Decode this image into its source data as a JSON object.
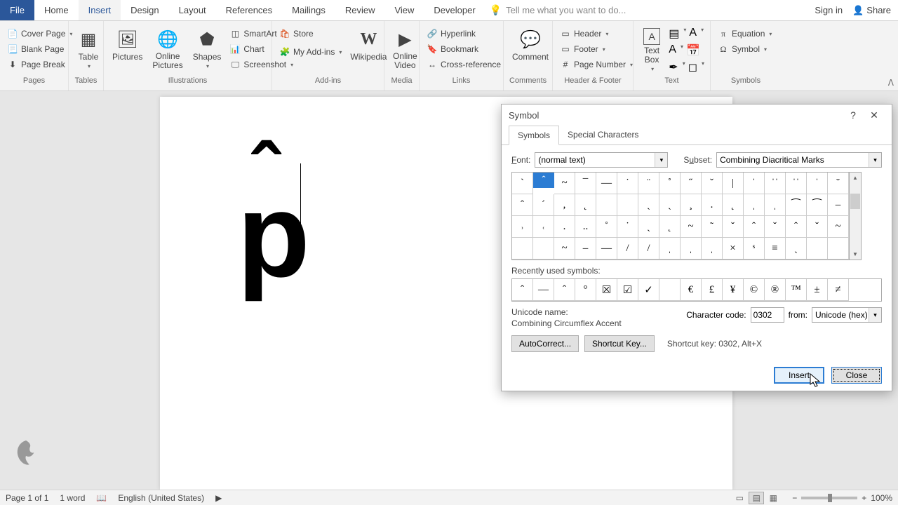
{
  "menubar": {
    "tabs": [
      "File",
      "Home",
      "Insert",
      "Design",
      "Layout",
      "References",
      "Mailings",
      "Review",
      "View",
      "Developer"
    ],
    "active": "Insert",
    "tellme": "Tell me what you want to do...",
    "signin": "Sign in",
    "share": "Share"
  },
  "ribbon": {
    "pages": {
      "label": "Pages",
      "cover": "Cover Page",
      "blank": "Blank Page",
      "break": "Page Break"
    },
    "tables": {
      "label": "Tables",
      "table": "Table"
    },
    "illus": {
      "label": "Illustrations",
      "pictures": "Pictures",
      "online": "Online Pictures",
      "shapes": "Shapes",
      "smartart": "SmartArt",
      "chart": "Chart",
      "screenshot": "Screenshot"
    },
    "addins": {
      "label": "Add-ins",
      "store": "Store",
      "myaddins": "My Add-ins",
      "wikipedia": "Wikipedia"
    },
    "media": {
      "label": "Media",
      "video": "Online Video"
    },
    "links": {
      "label": "Links",
      "hyperlink": "Hyperlink",
      "bookmark": "Bookmark",
      "crossref": "Cross-reference"
    },
    "comments": {
      "label": "Comments",
      "comment": "Comment"
    },
    "headerfooter": {
      "label": "Header & Footer",
      "header": "Header",
      "footer": "Footer",
      "pagenum": "Page Number"
    },
    "text": {
      "label": "Text",
      "textbox": "Text Box"
    },
    "symbols": {
      "label": "Symbols",
      "equation": "Equation",
      "symbol": "Symbol"
    }
  },
  "document": {
    "char": "p",
    "accent": "ˆ"
  },
  "dialog": {
    "title": "Symbol",
    "tabs": [
      "Symbols",
      "Special Characters"
    ],
    "font_label": "Font:",
    "font_value": "(normal text)",
    "subset_label": "Subset:",
    "subset_value": "Combining Diacritical Marks",
    "grid": [
      [
        "`",
        "ˆ",
        "~",
        "¯",
        "—",
        "˙",
        "¨",
        "˚",
        "˝",
        "ˇ",
        "|",
        "ˈ",
        "ˈˈ",
        "ˈˈ",
        "ˈ",
        "˘"
      ],
      [
        "ˆ",
        "´",
        ",",
        "˛",
        "",
        "",
        "ˏ",
        "ˏ",
        "¸",
        ".",
        "˛",
        "ˌ",
        "ˌ",
        "⁀",
        "⁀",
        "–"
      ],
      [
        "˒",
        "˓",
        ".",
        "..",
        "˚",
        "˙",
        "ˏ",
        "˛",
        "~",
        "˜",
        "ˇ",
        "ˆ",
        "ˇ",
        "ˆ",
        "ˇ",
        "~"
      ],
      [
        "",
        "",
        "~",
        "–",
        "—",
        "/",
        "/",
        "ˌ",
        "ˌ",
        "ˌ",
        "×",
        "ˢ",
        "≡",
        "ˏ",
        "",
        ""
      ]
    ],
    "selected_row": 0,
    "selected_col": 1,
    "recent_label": "Recently used symbols:",
    "recent": [
      "ˆ",
      "—",
      "ˆ",
      "°",
      "☒",
      "☑",
      "✓",
      "",
      "€",
      "£",
      "¥",
      "©",
      "®",
      "™",
      "±",
      "≠"
    ],
    "unicode_name_label": "Unicode name:",
    "unicode_name": "Combining Circumflex Accent",
    "char_code_label": "Character code:",
    "char_code": "0302",
    "from_label": "from:",
    "from_value": "Unicode (hex)",
    "autocorrect": "AutoCorrect...",
    "shortcutkey_btn": "Shortcut Key...",
    "shortcut_text": "Shortcut key: 0302, Alt+X",
    "insert": "Insert",
    "close": "Close"
  },
  "status": {
    "page": "Page 1 of 1",
    "words": "1 word",
    "lang": "English (United States)",
    "zoom": "100%"
  }
}
